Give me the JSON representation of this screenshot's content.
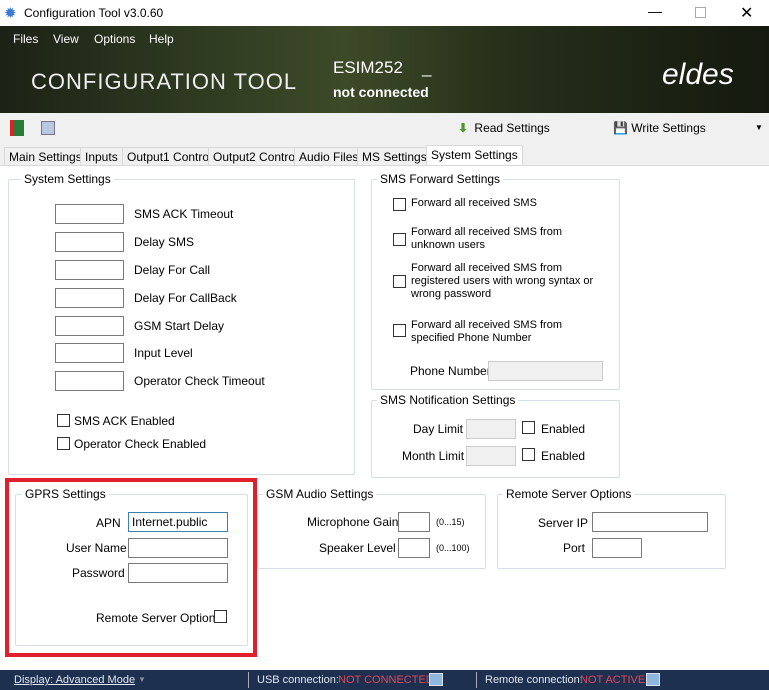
{
  "window": {
    "title": "Configuration Tool v3.0.60"
  },
  "menu": [
    "Files",
    "View",
    "Options",
    "Help"
  ],
  "header": {
    "app_name": "CONFIGURATION TOOL",
    "device": "ESIM252",
    "device_suffix": "_",
    "connection": "not connected",
    "logo": "eldes"
  },
  "toolbar": {
    "read": "Read Settings",
    "write": "Write Settings"
  },
  "tabs": [
    "Main Settings",
    "Inputs",
    "Output1 Control",
    "Output2 Control",
    "Audio Files",
    "MS Settings",
    "System Settings"
  ],
  "system_settings": {
    "title": "System Settings",
    "fields": [
      {
        "label": "SMS ACK Timeout",
        "value": ""
      },
      {
        "label": "Delay SMS",
        "value": ""
      },
      {
        "label": "Delay For Call",
        "value": ""
      },
      {
        "label": "Delay For CallBack",
        "value": ""
      },
      {
        "label": "GSM Start Delay",
        "value": ""
      },
      {
        "label": "Input Level",
        "value": ""
      },
      {
        "label": "Operator Check Timeout",
        "value": ""
      }
    ],
    "checkboxes": [
      {
        "label": "SMS ACK Enabled",
        "checked": false
      },
      {
        "label": "Operator Check Enabled",
        "checked": false
      }
    ]
  },
  "sms_forward": {
    "title": "SMS Forward Settings",
    "options": [
      {
        "label": "Forward all received SMS",
        "checked": false
      },
      {
        "label": "Forward all received SMS from unknown users",
        "checked": false
      },
      {
        "label": "Forward all received SMS from registered users with wrong syntax or wrong password",
        "checked": false
      },
      {
        "label": "Forward all received SMS from specified Phone Number",
        "checked": false
      }
    ],
    "phone_label": "Phone Number",
    "phone_value": ""
  },
  "sms_notification": {
    "title": "SMS Notification Settings",
    "day_label": "Day Limit",
    "month_label": "Month Limit",
    "enabled_label": "Enabled"
  },
  "gprs": {
    "title": "GPRS Settings",
    "apn_label": "APN",
    "apn_value": "Internet.public",
    "user_label": "User Name",
    "user_value": "",
    "password_label": "Password",
    "password_value": "",
    "remote_label": "Remote Server Options"
  },
  "gsm_audio": {
    "title": "GSM Audio Settings",
    "mic_label": "Microphone Gain",
    "mic_range": "(0...15)",
    "spk_label": "Speaker Level",
    "spk_range": "(0...100)"
  },
  "remote_server": {
    "title": "Remote Server Options",
    "ip_label": "Server IP",
    "port_label": "Port"
  },
  "status": {
    "display": "Display: Advanced Mode",
    "usb_label": "USB connection:",
    "usb_value": "NOT CONNECTED",
    "remote_label": "Remote connection:",
    "remote_value": "NOT ACTIVE"
  },
  "colors": {
    "highlight": "#e0202a",
    "status_bar": "#1e3050",
    "status_alert": "#e0475a"
  }
}
